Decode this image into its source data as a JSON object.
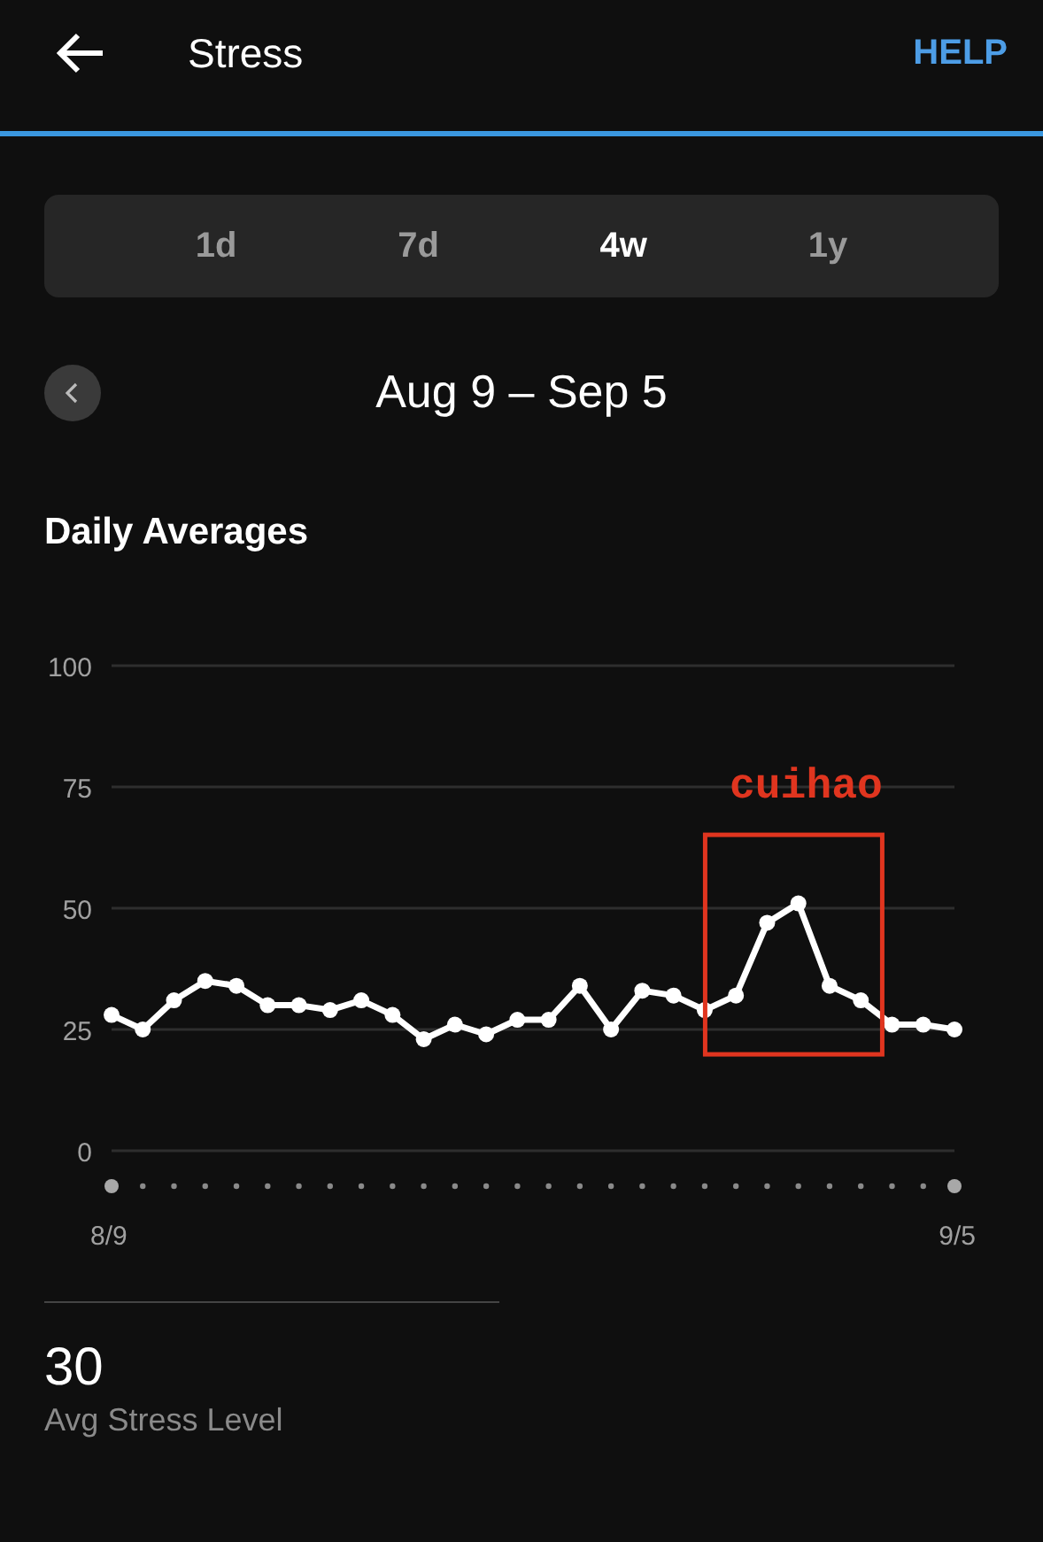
{
  "header": {
    "title": "Stress",
    "help": "HELP"
  },
  "ranges": [
    {
      "label": "1d",
      "selected": false
    },
    {
      "label": "7d",
      "selected": false
    },
    {
      "label": "4w",
      "selected": true
    },
    {
      "label": "1y",
      "selected": false
    }
  ],
  "period": {
    "label": "Aug 9 – Sep 5"
  },
  "chart_section": {
    "title": "Daily Averages",
    "chart_data": {
      "type": "line",
      "ylim": [
        0,
        100
      ],
      "yticks": [
        0,
        25,
        50,
        75,
        100
      ],
      "grid": true,
      "categories": [
        "8/9",
        null,
        null,
        null,
        null,
        null,
        null,
        null,
        null,
        null,
        null,
        null,
        null,
        null,
        null,
        null,
        null,
        null,
        null,
        null,
        null,
        null,
        null,
        null,
        null,
        null,
        null,
        "9/5"
      ],
      "series": [
        {
          "color": "#ffffff",
          "marker": "circle",
          "values": [
            28,
            25,
            31,
            35,
            34,
            30,
            30,
            29,
            31,
            28,
            23,
            26,
            24,
            27,
            27,
            34,
            25,
            33,
            32,
            29,
            32,
            47,
            51,
            34,
            31,
            26,
            26,
            25
          ]
        }
      ],
      "annotations": [
        "cuihao"
      ]
    }
  },
  "summary": {
    "value": "30",
    "label": "Avg Stress Level"
  }
}
